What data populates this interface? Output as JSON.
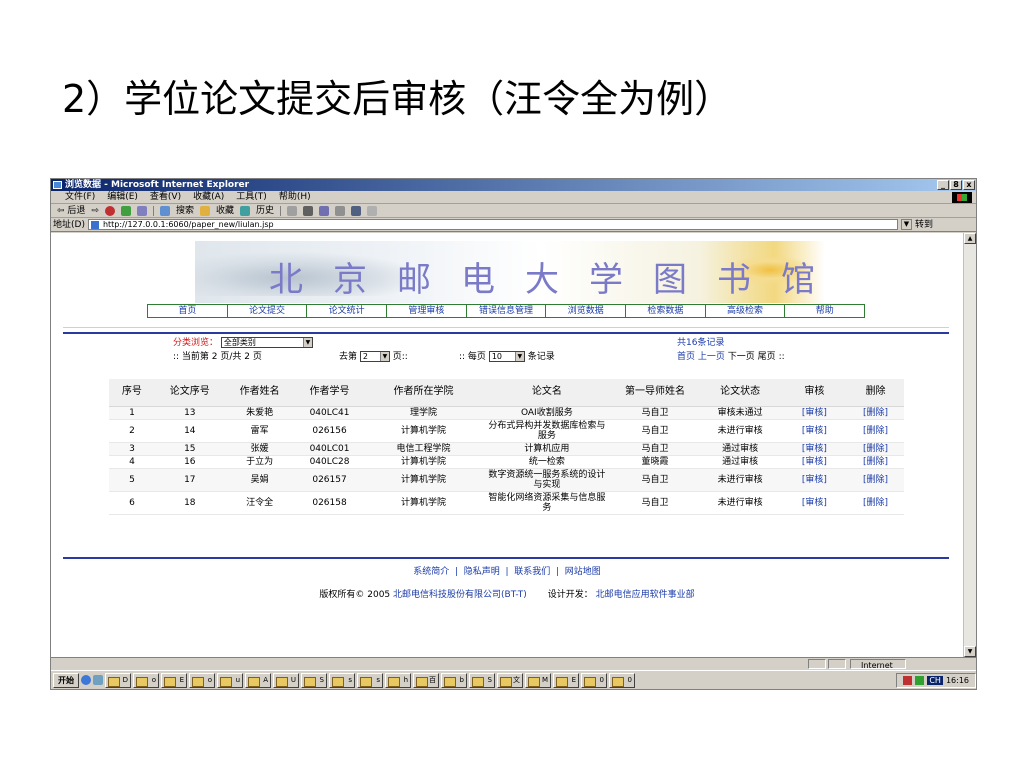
{
  "slide_title": "2）学位论文提交后审核（汪令全为例）",
  "window": {
    "title": "浏览数据 - Microsoft Internet Explorer",
    "buttons": [
      "_",
      "8",
      "x"
    ]
  },
  "menu": [
    "文件(F)",
    "编辑(E)",
    "查看(V)",
    "收藏(A)",
    "工具(T)",
    "帮助(H)"
  ],
  "toolbar": {
    "back": "⇦ 后退",
    "forward": "⇨",
    "search": "搜索",
    "favorites": "收藏",
    "history": "历史"
  },
  "address": {
    "label": "地址(D)",
    "url": "http://127.0.0.1:6060/paper_new/liulan.jsp",
    "go": "转到"
  },
  "banner_title": "北京邮电大学图书馆",
  "nav": [
    "首页",
    "论文提交",
    "论文统计",
    "管理审核",
    "错误信息管理",
    "浏览数据",
    "检索数据",
    "高级检索",
    "帮助"
  ],
  "filter": {
    "label": "分类浏览：",
    "category": "全部类别",
    "total": "共16条记录",
    "page_info": ":: 当前第 2 页/共 2 页",
    "goto_prefix": "去第",
    "goto_value": "2",
    "goto_suffix": "页::",
    "per_page_prefix": ":: 每页",
    "per_page_value": "10",
    "per_page_suffix": "条记录",
    "pager": [
      "首页",
      "上一页",
      "下一页",
      "尾页"
    ],
    "pager_end": "::"
  },
  "table": {
    "headers": [
      "序号",
      "论文序号",
      "作者姓名",
      "作者学号",
      "作者所在学院",
      "论文名",
      "第一导师姓名",
      "论文状态",
      "审核",
      "删除"
    ],
    "rows": [
      [
        "1",
        "13",
        "朱爱艳",
        "040LC41",
        "理学院",
        "OAI收割服务",
        "马自卫",
        "审核未通过",
        "[审核]",
        "[删除]"
      ],
      [
        "2",
        "14",
        "雷军",
        "026156",
        "计算机学院",
        "分布式异构并发数据库检索与服务",
        "马自卫",
        "未进行审核",
        "[审核]",
        "[删除]"
      ],
      [
        "3",
        "15",
        "张媛",
        "040LC01",
        "电信工程学院",
        "计算机应用",
        "马自卫",
        "通过审核",
        "[审核]",
        "[删除]"
      ],
      [
        "4",
        "16",
        "于立为",
        "040LC28",
        "计算机学院",
        "统一检索",
        "董晓霞",
        "通过审核",
        "[审核]",
        "[删除]"
      ],
      [
        "5",
        "17",
        "吴娟",
        "026157",
        "计算机学院",
        "数字资源统一服务系统的设计与实现",
        "马自卫",
        "未进行审核",
        "[审核]",
        "[删除]"
      ],
      [
        "6",
        "18",
        "汪令全",
        "026158",
        "计算机学院",
        "智能化网络资源采集与信息服务",
        "马自卫",
        "未进行审核",
        "[审核]",
        "[删除]"
      ]
    ]
  },
  "footer": {
    "links": [
      "系统简介",
      "隐私声明",
      "联系我们",
      "网站地图"
    ],
    "copyright_prefix": "版权所有© 2005",
    "company": "北邮电信科技股份有限公司(BT-T)",
    "design_label": "设计开发：",
    "designer": "北邮电信应用软件事业部"
  },
  "status": {
    "zone": "Internet"
  },
  "taskbar": {
    "start": "开始",
    "buttons": [
      "D",
      "o",
      "E",
      "o",
      "u",
      "A",
      "U",
      "S",
      "s",
      "s",
      "h",
      "百",
      "b",
      "S",
      "文",
      "M",
      "E",
      "0",
      "0"
    ],
    "lang": "CH",
    "time": "16:16"
  },
  "colors": {
    "title_gradient_start": "#0a246a",
    "nav_border": "#2e7d32",
    "link": "#1a3aa8",
    "rule": "#2b3aa0",
    "red_label": "#d01818"
  }
}
